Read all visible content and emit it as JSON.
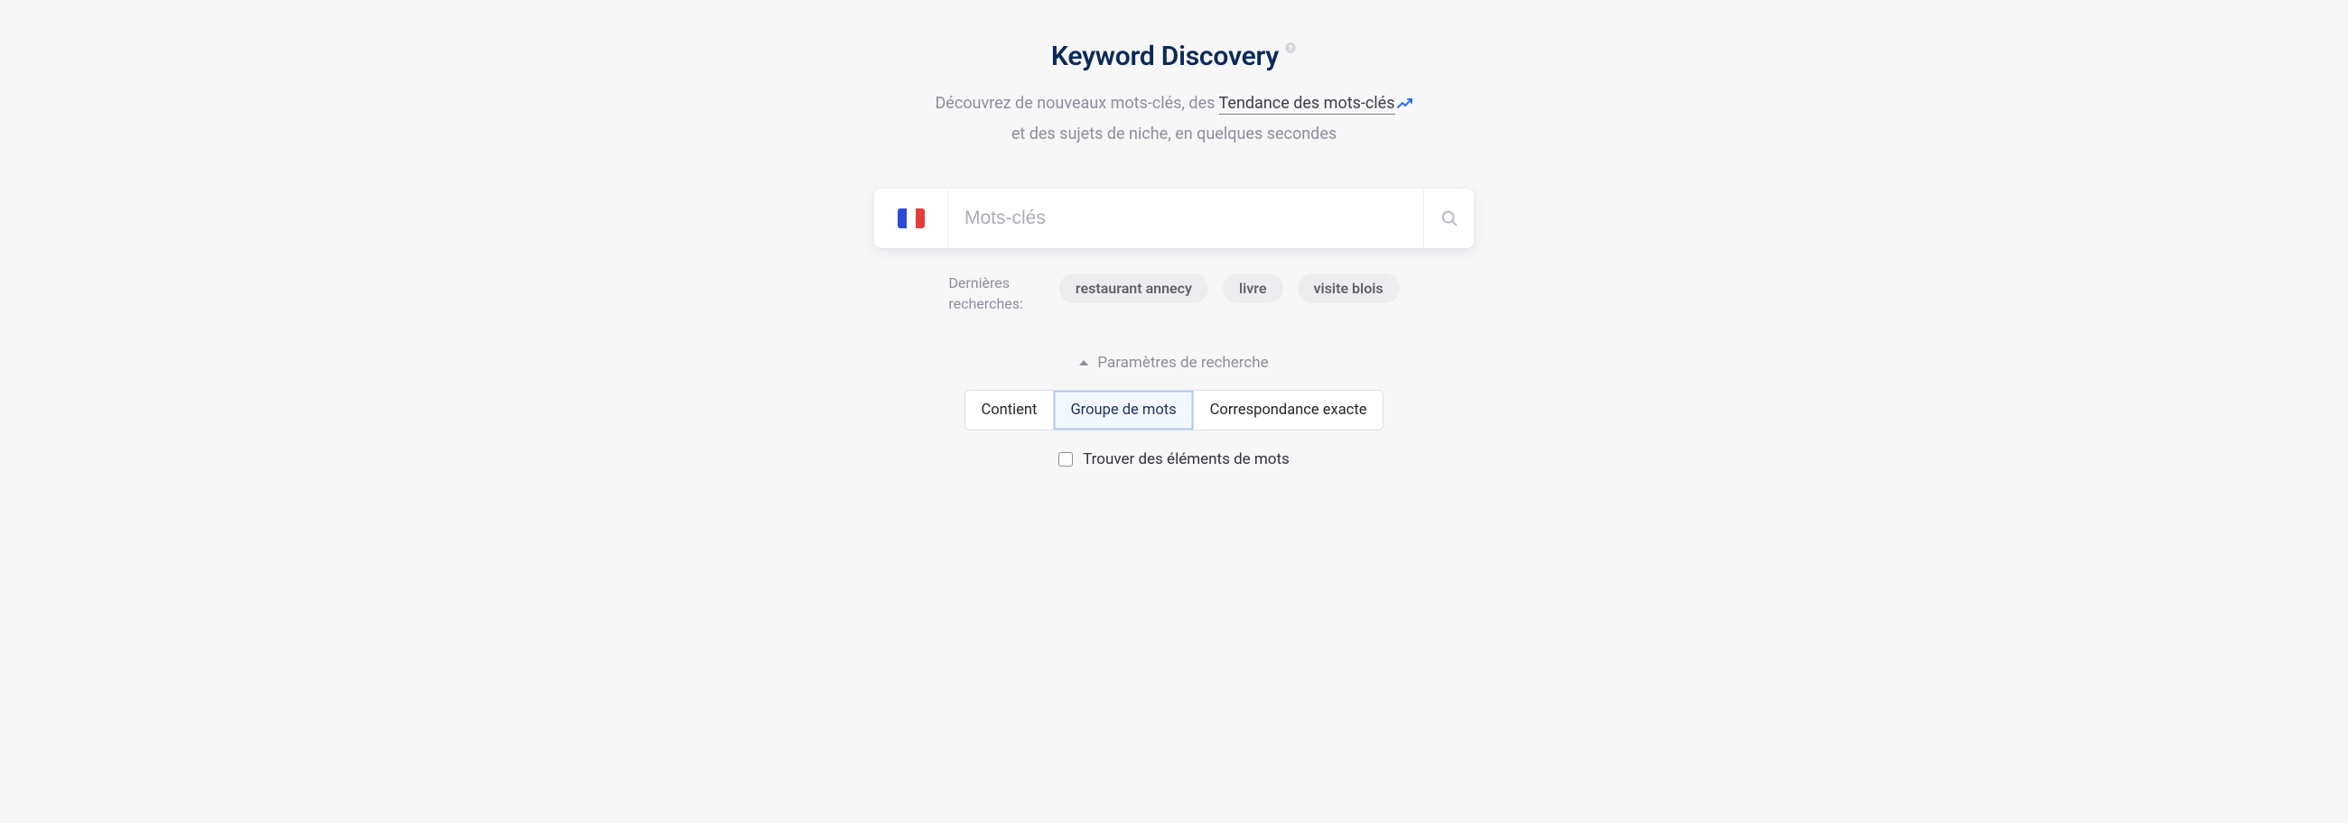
{
  "title": "Keyword Discovery",
  "subtitle_part1": "Découvrez de nouveaux mots-clés, des ",
  "trend_link_text": "Tendance des mots-clés",
  "subtitle_part2": " et des sujets de niche, en quelques secondes",
  "search": {
    "placeholder": "Mots-clés",
    "value": "",
    "country": "France"
  },
  "recent": {
    "label_line1": "Dernières",
    "label_line2": "recherches:",
    "chips": [
      "restaurant annecy",
      "livre",
      "visite blois"
    ]
  },
  "params": {
    "toggle_label": "Paramètres de recherche",
    "options": [
      "Contient",
      "Groupe de mots",
      "Correspondance exacte"
    ],
    "active_index": 1,
    "checkbox_label": "Trouver des éléments de mots",
    "checkbox_checked": false
  },
  "colors": {
    "accent": "#0b2a5b",
    "muted": "#8a8f99",
    "chip_bg": "#ededef",
    "seg_active_bg": "#f3f8ff",
    "seg_active_border": "#a9c6ff"
  }
}
